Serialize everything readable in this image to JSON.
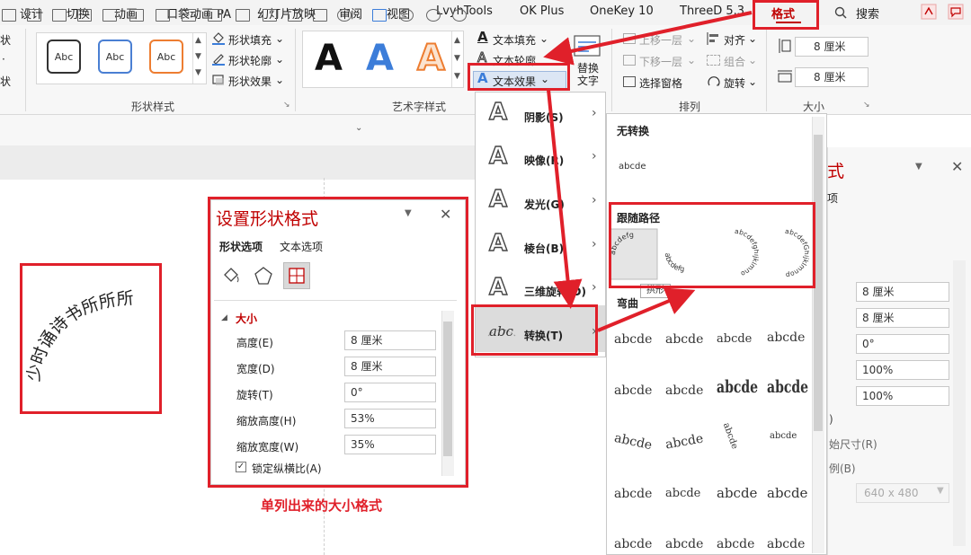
{
  "tabs": [
    "设计",
    "切换",
    "动画",
    "口袋动画 PA",
    "幻灯片放映",
    "审阅",
    "视图",
    "LvyhTools",
    "OK Plus",
    "OneKey 10",
    "ThreeD 5.3",
    "格式",
    "搜索"
  ],
  "ribbon": {
    "left_cut": [
      "状",
      "·",
      "状"
    ],
    "shape_styles": {
      "label": "形状样式",
      "boxes": [
        "Abc",
        "Abc",
        "Abc"
      ],
      "fill": "形状填充",
      "outline": "形状轮廓",
      "effects": "形状效果"
    },
    "wordart": {
      "label": "艺术字样式",
      "letters": [
        "A",
        "A",
        "A"
      ],
      "text_fill": "文本填充",
      "text_outline": "文本轮廓",
      "text_effects": "文本效果"
    },
    "alt_text": "替换文字",
    "arrange": {
      "label": "排列",
      "bring_forward": "上移一层",
      "send_backward": "下移一层",
      "selection_pane": "选择窗格",
      "align": "对齐",
      "group": "组合",
      "rotate": "旋转"
    },
    "size": {
      "label": "大小",
      "height": "8 厘米",
      "width": "8 厘米"
    }
  },
  "slide_text": "少时诵诗书所所所",
  "format_pane": {
    "title": "设置形状格式",
    "tab_shape": "形状选项",
    "tab_text": "文本选项",
    "section": "大小",
    "fields": [
      {
        "label": "高度(E)",
        "value": "8 厘米"
      },
      {
        "label": "宽度(D)",
        "value": "8 厘米"
      },
      {
        "label": "旋转(T)",
        "value": "0°"
      },
      {
        "label": "缩放高度(H)",
        "value": "53%"
      },
      {
        "label": "缩放宽度(W)",
        "value": "35%"
      }
    ],
    "lock_ratio": "锁定纵横比(A)"
  },
  "caption": "单列出来的大小格式",
  "effects_menu": [
    "阴影(S)",
    "映像(R)",
    "发光(G)",
    "棱台(B)",
    "三维旋转(D)",
    "转换(T)"
  ],
  "transform_gallery": {
    "no_transform_head": "无转换",
    "no_transform_sample": "abcde",
    "follow_path_head": "跟随路径",
    "path_samples": [
      "abcdefg",
      "abcdefg",
      "abcdefghijklmno",
      "abcdefGhijklmnop"
    ],
    "tooltip": "拱形",
    "warp_head": "弯曲",
    "warp_rows": [
      [
        "abcde",
        "abcde",
        "abcde",
        "abcde"
      ],
      [
        "abcde",
        "abcde",
        "abcde",
        "abcde"
      ],
      [
        "abcde",
        "abcde",
        "abcde",
        "abcde"
      ],
      [
        "abcde",
        "abcde",
        "abcde",
        "abcde"
      ],
      [
        "abcde",
        "abcde",
        "abcde",
        "abcde"
      ]
    ]
  },
  "right_pane": {
    "title_partial": "式",
    "sub_partial": "项",
    "values": [
      "8 厘米",
      "8 厘米",
      "0°",
      "100%",
      "100%"
    ],
    "labels": [
      "始尺寸(R)",
      "例(B)"
    ],
    "resolution": "640 x 480"
  },
  "colors": {
    "accent": "#c00000",
    "annotation_red": "#e0202a",
    "wordart_blue": "#3c7dd9",
    "wordart_orange": "#ed7d31"
  }
}
